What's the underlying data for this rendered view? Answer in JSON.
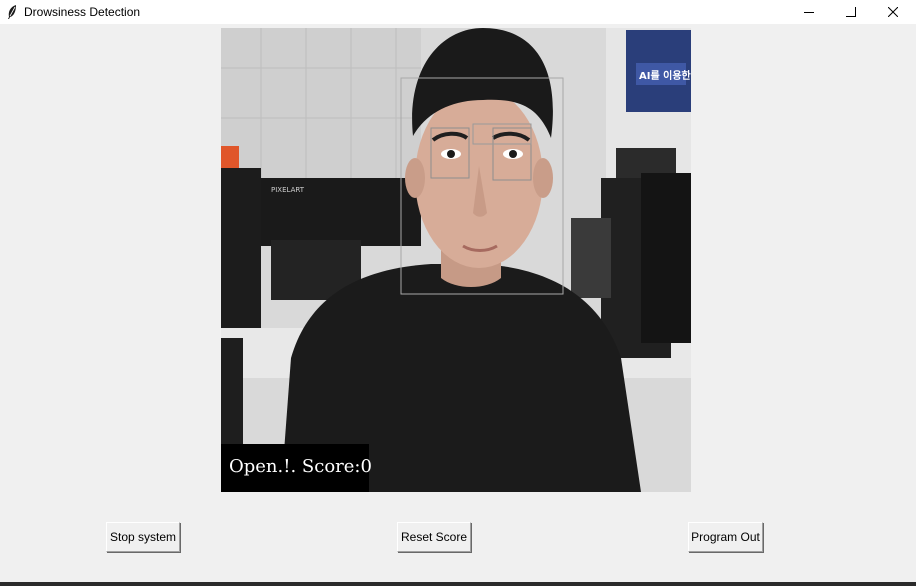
{
  "window": {
    "title": "Drowsiness Detection"
  },
  "video": {
    "overlay_text": "Open.!. Score:0",
    "background_sign_text": "AI를 이용한"
  },
  "buttons": {
    "stop_label": "Stop system",
    "reset_label": "Reset Score",
    "out_label": "Program Out"
  }
}
